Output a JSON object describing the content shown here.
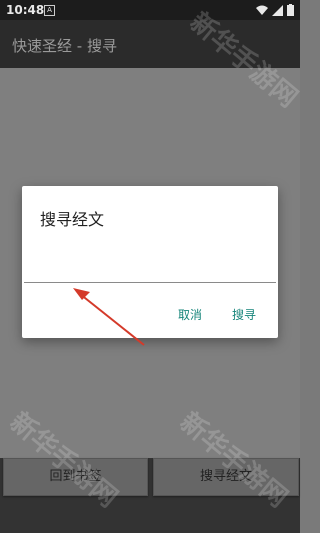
{
  "status_bar": {
    "time": "10:48"
  },
  "app_bar": {
    "title": "快速圣经 - 搜寻"
  },
  "dialog": {
    "title": "搜寻经文",
    "input_value": "",
    "cancel_label": "取消",
    "search_label": "搜寻"
  },
  "bottom_buttons": {
    "bookmark_label": "回到书签",
    "search_label": "搜寻经文"
  },
  "watermark": {
    "text": "新华手游网"
  },
  "colors": {
    "accent": "#16857a",
    "annotation_arrow": "#d43a2a"
  },
  "icons": [
    "notification-icon",
    "wifi-icon",
    "signal-icon",
    "battery-icon"
  ]
}
